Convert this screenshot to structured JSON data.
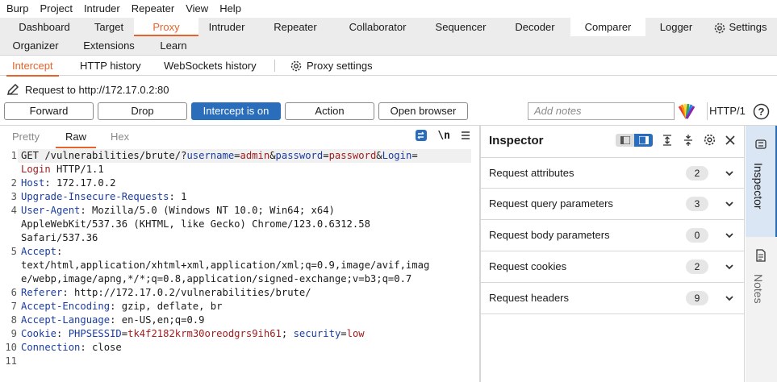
{
  "menu": [
    "Burp",
    "Project",
    "Intruder",
    "Repeater",
    "View",
    "Help"
  ],
  "top_tabs_row1": [
    "Dashboard",
    "Target",
    "Proxy",
    "Intruder",
    "Repeater",
    "Collaborator",
    "Sequencer",
    "Decoder",
    "Comparer",
    "Logger",
    "Settings"
  ],
  "top_tabs_row2": [
    "Organizer",
    "Extensions",
    "Learn"
  ],
  "sub_tabs": [
    "Intercept",
    "HTTP history",
    "WebSockets history",
    "Proxy settings"
  ],
  "request_info": "Request to http://172.17.0.2:80",
  "buttons": {
    "forward": "Forward",
    "drop": "Drop",
    "intercept": "Intercept is on",
    "action": "Action",
    "open_browser": "Open browser"
  },
  "notes_placeholder": "Add notes",
  "http_version": "HTTP/1",
  "help": "?",
  "editor": {
    "tabs": [
      "Pretty",
      "Raw",
      "Hex"
    ],
    "newline_toggle": "\\n",
    "line_numbers": [
      "1",
      "",
      "2",
      "3",
      "4",
      "",
      "",
      "5",
      "",
      "",
      "6",
      "7",
      "8",
      "9",
      "10",
      "11"
    ],
    "lines": [
      [
        [
          "p",
          "GET /vulnerabilities/brute/?"
        ],
        [
          "k",
          "username"
        ],
        [
          "p",
          "="
        ],
        [
          "v",
          "admin"
        ],
        [
          "p",
          "&"
        ],
        [
          "k",
          "password"
        ],
        [
          "p",
          "="
        ],
        [
          "v",
          "password"
        ],
        [
          "p",
          "&"
        ],
        [
          "k",
          "Login"
        ],
        [
          "p",
          "="
        ]
      ],
      [
        [
          "v",
          "Login"
        ],
        [
          "p",
          " HTTP/1.1"
        ]
      ],
      [
        [
          "k",
          "Host"
        ],
        [
          "p",
          ": 172.17.0.2"
        ]
      ],
      [
        [
          "k",
          "Upgrade-Insecure-Requests"
        ],
        [
          "p",
          ": 1"
        ]
      ],
      [
        [
          "k",
          "User-Agent"
        ],
        [
          "p",
          ": Mozilla/5.0 (Windows NT 10.0; Win64; x64)"
        ]
      ],
      [
        [
          "p",
          "AppleWebKit/537.36 (KHTML, like Gecko) Chrome/123.0.6312.58"
        ]
      ],
      [
        [
          "p",
          "Safari/537.36"
        ]
      ],
      [
        [
          "k",
          "Accept"
        ],
        [
          "p",
          ":"
        ]
      ],
      [
        [
          "p",
          "text/html,application/xhtml+xml,application/xml;q=0.9,image/avif,imag"
        ]
      ],
      [
        [
          "p",
          "e/webp,image/apng,*/*;q=0.8,application/signed-exchange;v=b3;q=0.7"
        ]
      ],
      [
        [
          "k",
          "Referer"
        ],
        [
          "p",
          ": http://172.17.0.2/vulnerabilities/brute/"
        ]
      ],
      [
        [
          "k",
          "Accept-Encoding"
        ],
        [
          "p",
          ": gzip, deflate, br"
        ]
      ],
      [
        [
          "k",
          "Accept-Language"
        ],
        [
          "p",
          ": en-US,en;q=0.9"
        ]
      ],
      [
        [
          "k",
          "Cookie"
        ],
        [
          "p",
          ": "
        ],
        [
          "k",
          "PHPSESSID"
        ],
        [
          "p",
          "="
        ],
        [
          "v",
          "tk4f2182krm30oreodgrs9ih61"
        ],
        [
          "p",
          "; "
        ],
        [
          "k",
          "security"
        ],
        [
          "p",
          "="
        ],
        [
          "v",
          "low"
        ]
      ],
      [
        [
          "k",
          "Connection"
        ],
        [
          "p",
          ": close"
        ]
      ],
      []
    ]
  },
  "inspector": {
    "title": "Inspector",
    "rows": [
      {
        "label": "Request attributes",
        "count": "2"
      },
      {
        "label": "Request query parameters",
        "count": "3"
      },
      {
        "label": "Request body parameters",
        "count": "0"
      },
      {
        "label": "Request cookies",
        "count": "2"
      },
      {
        "label": "Request headers",
        "count": "9"
      }
    ]
  },
  "side_rail": [
    "Inspector",
    "Notes"
  ],
  "colors": {
    "accent_orange": "#e8632b",
    "primary_blue": "#2a6ebb",
    "key_blue": "#1a3da0",
    "value_red": "#a11d1d"
  }
}
